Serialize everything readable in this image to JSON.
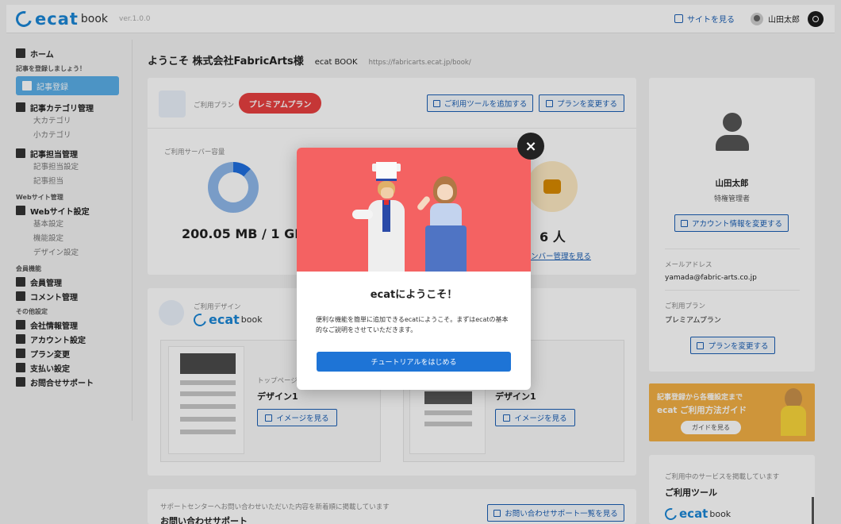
{
  "header": {
    "logo_ecat": "ecat",
    "logo_book": "book",
    "version": "ver.1.0.0",
    "site_link": "サイトを見る",
    "user_name": "山田太郎"
  },
  "sidebar": {
    "home": "ホーム",
    "post_prompt": "記事を登録しましょう！",
    "post_register": "記事登録",
    "category_mgmt": "記事カテゴリ管理",
    "category_large": "大カテゴリ",
    "category_small": "小カテゴリ",
    "author_mgmt": "記事担当管理",
    "author_setting": "記事担当設定",
    "author_report": "記事担当",
    "web_section": "Webサイト管理",
    "web_settings": "Webサイト設定",
    "basic_settings": "基本設定",
    "function_settings": "機能設定",
    "design_settings": "デザイン設定",
    "member_section": "会員機能",
    "member_mgmt": "会員管理",
    "comment_mgmt": "コメント管理",
    "other_section": "その他設定",
    "company_mgmt": "会社情報管理",
    "account_settings": "アカウント設定",
    "plan_change": "プラン変更",
    "payment_settings": "支払い設定",
    "support": "お問合せサポート"
  },
  "main": {
    "welcome_title": "ようこそ 株式会社FabricArts様",
    "welcome_site": "ecat BOOK",
    "welcome_url": "https://fabricarts.ecat.jp/book/",
    "plan_label": "ご利用プラン",
    "plan_name": "プレミアムプラン",
    "add_tool_btn": "ご利用ツールを追加する",
    "change_plan_btn": "プランを変更する",
    "server_label": "ご利用サーバー容量",
    "server_value": "200.05 MB",
    "server_total": "/ 1 GB",
    "member_value": "6 人",
    "member_link": "ンバー管理を見る",
    "design_label": "ご利用デザイン",
    "design_logo_ecat": "ecat",
    "design_logo_book": "book",
    "top_page": "トップページ",
    "design_name_1": "デザイン1",
    "design_name_2": "デザイン1",
    "view_image": "イメージを見る",
    "support_caption": "サポートセンターへお問い合わせいただいた内容を新着順に掲載しています",
    "support_title": "お問い合わせサポート",
    "support_btn": "お問い合わせサポート一覧を見る"
  },
  "right": {
    "user_name": "山田太郎",
    "user_role": "特権管理者",
    "account_btn": "アカウント情報を変更する",
    "email_label": "メールアドレス",
    "email": "yamada@fabric-arts.co.jp",
    "plan_label": "ご利用プラン",
    "plan_value": "プレミアムプラン",
    "plan_btn": "プランを変更する",
    "guide_line1": "記事登録から各種設定まで",
    "guide_line2": "ecat ご利用方法ガイド",
    "guide_btn": "ガイドを見る",
    "service_caption": "ご利用中のサービスを掲載しています",
    "service_title": "ご利用ツール",
    "service_logo_ecat": "ecat",
    "service_logo_book": "book"
  },
  "modal": {
    "title": "ecatにようこそ！",
    "text": "便利な機能を簡単に追加できるecatにようこそ。まずはecatの基本的なご説明をさせていただきます。",
    "button": "チュートリアルをはじめる",
    "close": "×"
  },
  "colors": {
    "accent": "#1a86d6",
    "plan_red": "#e84040",
    "hero_red": "#f46262",
    "guide_orange": "#f2b045"
  }
}
